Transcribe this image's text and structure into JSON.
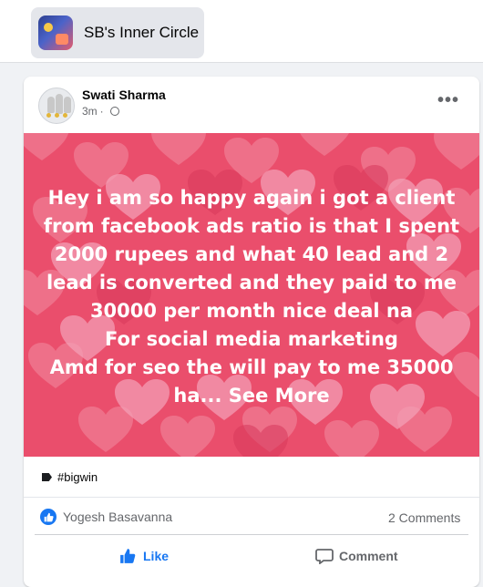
{
  "group": {
    "name": "SB's Inner Circle",
    "thumb_icon": "group-photo-thumbnail"
  },
  "post": {
    "author": "Swati Sharma",
    "time": "3m",
    "privacy_icon": "globe-icon",
    "more_icon": "more-options-icon",
    "text_lines": [
      "Hey i am so happy again i got a client",
      "from facebook ads ratio is that I spent",
      "2000 rupees and what 40 lead and 2",
      "lead is converted and they paid to me",
      "30000 per month nice deal na",
      "For social media marketing",
      "Amd for seo the will pay to me 35000"
    ],
    "last_line_prefix": "ha...",
    "see_more": "See More",
    "background_color": "#ea4e6c",
    "tag": "#bigwin"
  },
  "reactions": {
    "reactor": "Yogesh Basavanna",
    "comments": "2 Comments"
  },
  "actions": {
    "like": "Like",
    "comment": "Comment"
  },
  "colors": {
    "accent": "#1877f2",
    "secondary_text": "#65676b"
  }
}
